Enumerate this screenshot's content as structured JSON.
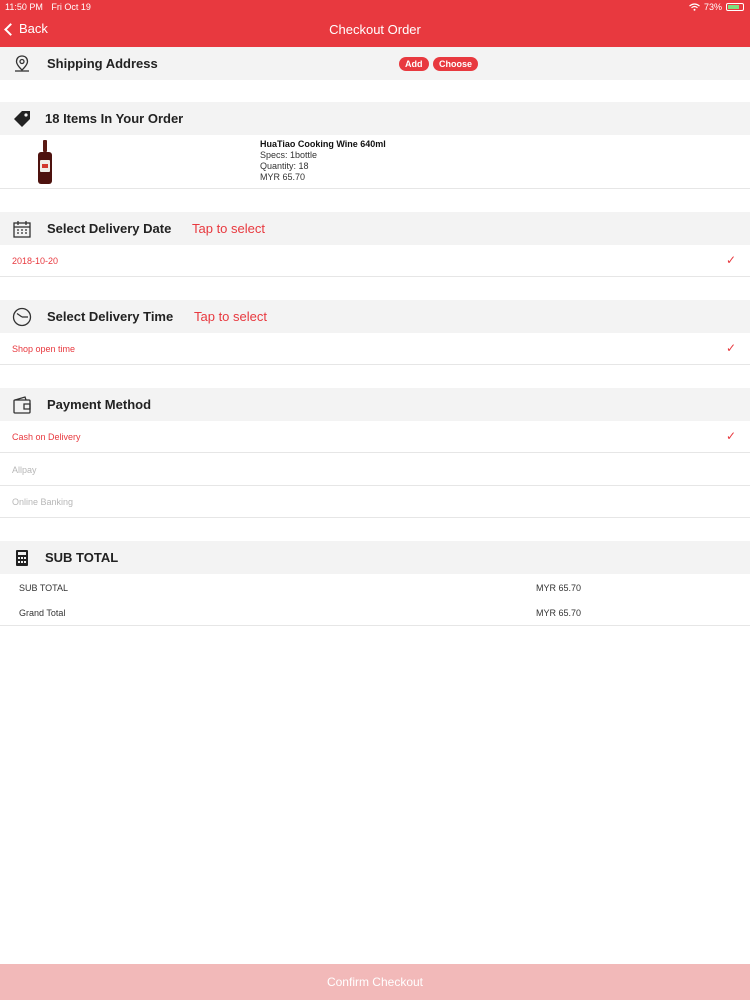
{
  "status_bar": {
    "time": "11:50 PM",
    "date": "Fri Oct 19",
    "battery": "73%"
  },
  "nav": {
    "back_label": "Back",
    "title": "Checkout Order"
  },
  "shipping": {
    "label": "Shipping Address",
    "add_label": "Add",
    "choose_label": "Choose"
  },
  "order": {
    "label": "18 Items In Your Order",
    "item": {
      "name": "HuaTiao Cooking Wine 640ml",
      "specs": "Specs: 1bottle",
      "quantity": "Quantity: 18",
      "price": "MYR 65.70"
    }
  },
  "delivery_date": {
    "label": "Select Delivery Date",
    "hint": "Tap to select",
    "value": "2018-10-20"
  },
  "delivery_time": {
    "label": "Select Delivery Time",
    "hint": "Tap to select",
    "value": "Shop open time"
  },
  "payment": {
    "label": "Payment Method",
    "options": [
      {
        "label": "Cash on Delivery",
        "selected": true
      },
      {
        "label": "Allpay",
        "selected": false
      },
      {
        "label": "Online Banking",
        "selected": false
      }
    ]
  },
  "subtotal": {
    "label": "SUB TOTAL",
    "rows": [
      {
        "key": "SUB TOTAL",
        "value": "MYR 65.70"
      },
      {
        "key": "Grand Total",
        "value": "MYR 65.70"
      }
    ]
  },
  "confirm_label": "Confirm Checkout",
  "colors": {
    "accent": "#e8393f",
    "confirm_bg": "#f2b9b9",
    "section_bg": "#f3f3f3"
  }
}
